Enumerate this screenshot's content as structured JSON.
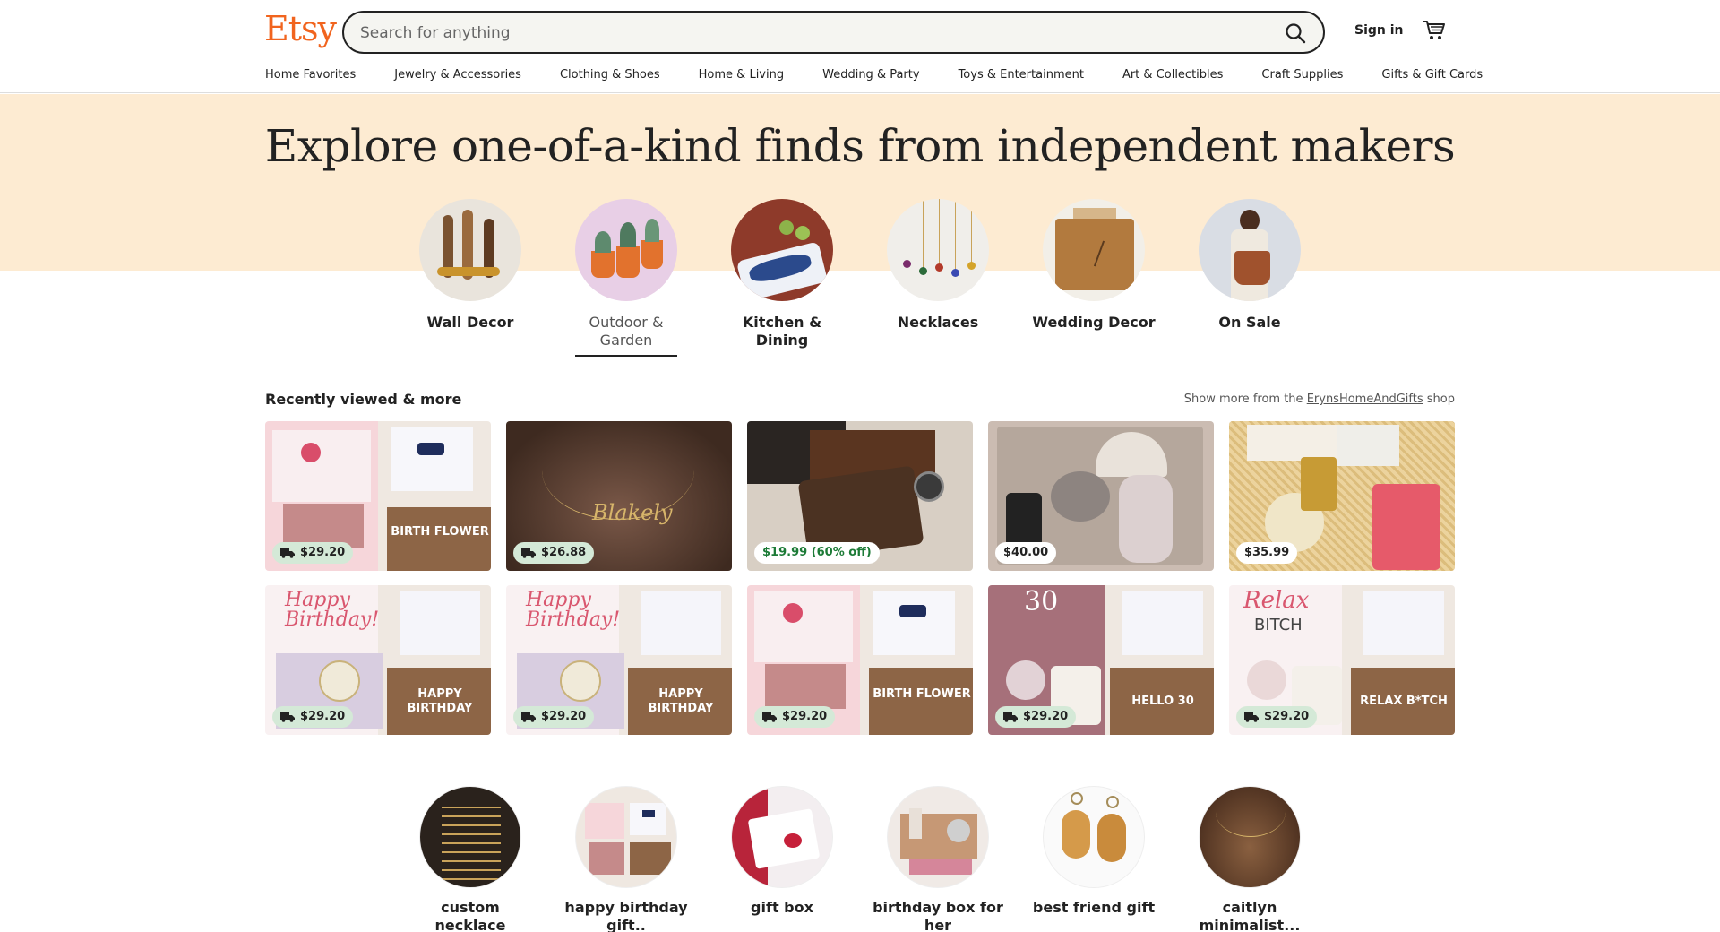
{
  "header": {
    "logo": "Etsy",
    "search_placeholder": "Search for anything",
    "signin_label": "Sign in",
    "search_icon": "search-icon",
    "cart_icon": "cart-icon",
    "brand_color": "#f1641e"
  },
  "nav": [
    "Home Favorites",
    "Jewelry & Accessories",
    "Clothing & Shoes",
    "Home & Living",
    "Wedding & Party",
    "Toys & Entertainment",
    "Art & Collectibles",
    "Craft Supplies",
    "Gifts & Gift Cards"
  ],
  "hero": {
    "title": "Explore one-of-a-kind finds from independent makers",
    "background": "#fdebd2",
    "categories": [
      {
        "label": "Wall Decor",
        "active": false
      },
      {
        "label": "Outdoor & Garden",
        "active": true
      },
      {
        "label": "Kitchen & Dining",
        "active": false
      },
      {
        "label": "Necklaces",
        "active": false
      },
      {
        "label": "Wedding Decor",
        "active": false
      },
      {
        "label": "On Sale",
        "active": false
      }
    ]
  },
  "recent": {
    "title": "Recently viewed & more",
    "show_more_prefix": "Show more from the",
    "shop_name": "ErynsHomeAndGifts",
    "show_more_suffix": "shop",
    "items": [
      {
        "price": "$29.20",
        "free_shipping": true,
        "tile_text": "BIRTH FLOWER"
      },
      {
        "price": "$26.88",
        "free_shipping": true,
        "tile_text": ""
      },
      {
        "price": "$19.99 (60% off)",
        "free_shipping": false,
        "sale": true,
        "tile_text": ""
      },
      {
        "price": "$40.00",
        "free_shipping": false,
        "tile_text": ""
      },
      {
        "price": "$35.99",
        "free_shipping": false,
        "tile_text": ""
      },
      {
        "price": "$29.20",
        "free_shipping": true,
        "tile_text": "HAPPY BIRTHDAY"
      },
      {
        "price": "$29.20",
        "free_shipping": true,
        "tile_text": "HAPPY BIRTHDAY"
      },
      {
        "price": "$29.20",
        "free_shipping": true,
        "tile_text": "BIRTH FLOWER"
      },
      {
        "price": "$29.20",
        "free_shipping": true,
        "tile_text": "HELLO 30"
      },
      {
        "price": "$29.20",
        "free_shipping": true,
        "tile_text": "RELAX B*TCH"
      }
    ]
  },
  "searches": [
    {
      "label": "custom necklace"
    },
    {
      "label": "happy birthday gift.."
    },
    {
      "label": "gift box"
    },
    {
      "label": "birthday box for her"
    },
    {
      "label": "best friend gift"
    },
    {
      "label": "caitlyn minimalist..."
    }
  ]
}
